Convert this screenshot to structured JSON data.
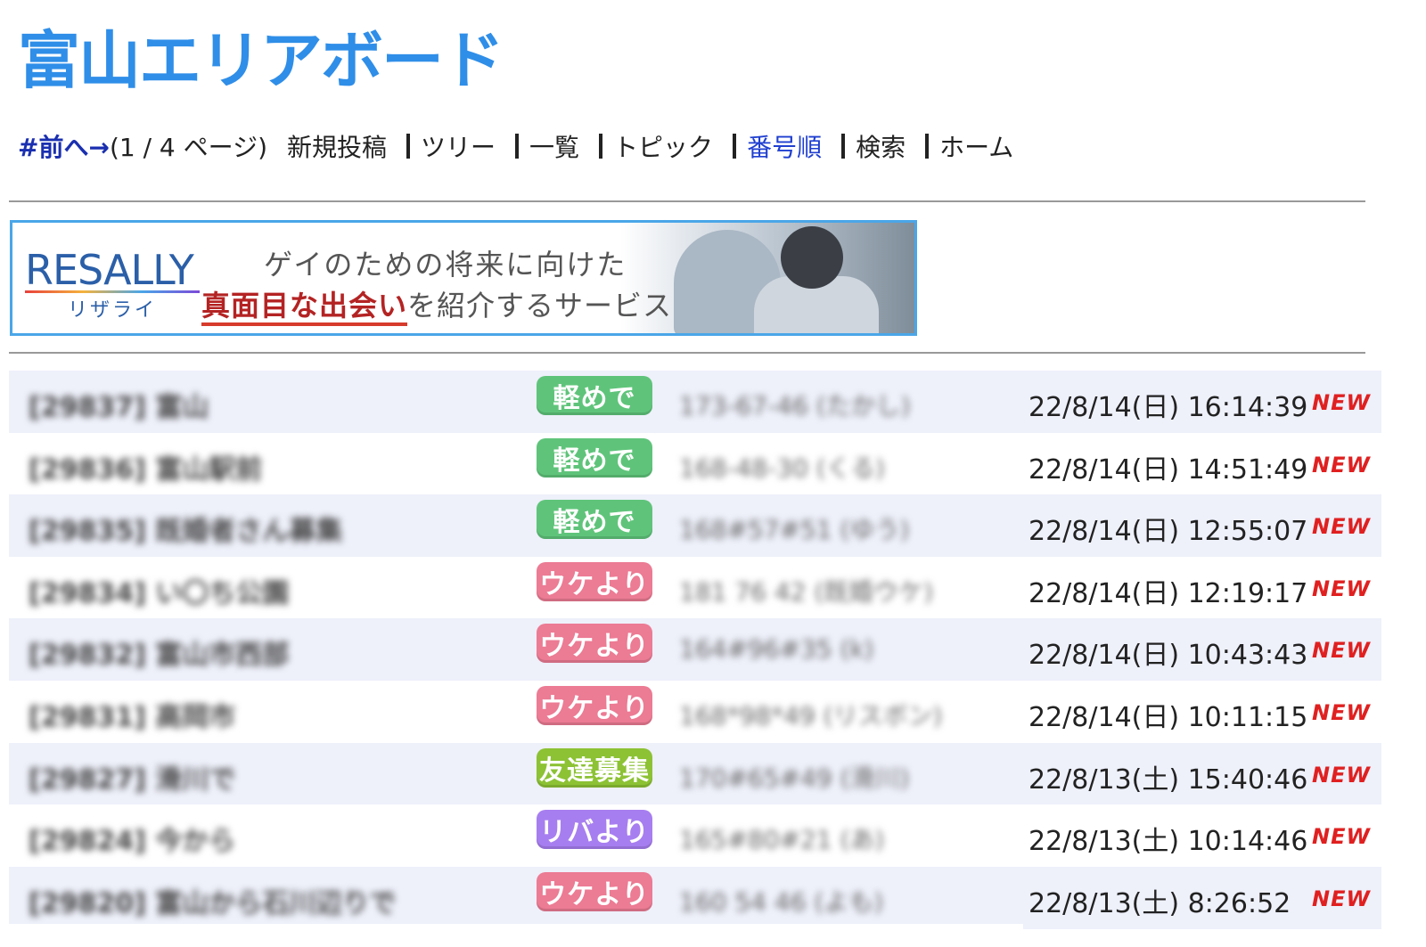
{
  "site": {
    "title": "富山エリアボード"
  },
  "nav": {
    "prev": "#前へ→",
    "page_info": "(1 / 4 ページ)",
    "items": [
      {
        "label": "新規投稿",
        "active": false
      },
      {
        "label": "ツリー",
        "active": false
      },
      {
        "label": "一覧",
        "active": false
      },
      {
        "label": "トピック",
        "active": false
      },
      {
        "label": "番号順",
        "active": true
      },
      {
        "label": "検索",
        "active": false
      },
      {
        "label": "ホーム",
        "active": false
      }
    ]
  },
  "banner": {
    "brand": "RESALLY",
    "brand_sub": "リザライ",
    "line1": "ゲイのための将来に向けた",
    "line2_highlight": "真面目な出会い",
    "line2_rest": "を紹介するサービス"
  },
  "posts": [
    {
      "title": "[29837] 富山",
      "tag": "軽めで",
      "tag_color": "green",
      "meta": "173-67-46 (たかし)",
      "date": "22/8/14(日) 16:14:39",
      "new": "NEW"
    },
    {
      "title": "[29836] 富山駅前",
      "tag": "軽めで",
      "tag_color": "green",
      "meta": "168-48-30 (くる)",
      "date": "22/8/14(日) 14:51:49",
      "new": "NEW"
    },
    {
      "title": "[29835] 既婚者さん募集",
      "tag": "軽めで",
      "tag_color": "green",
      "meta": "168#57#51 (ゆう)",
      "date": "22/8/14(日) 12:55:07",
      "new": "NEW"
    },
    {
      "title": "[29834] い〇ち公園",
      "tag": "ウケより",
      "tag_color": "pink",
      "meta": "181 76 42 (既婚ウケ)",
      "date": "22/8/14(日) 12:19:17",
      "new": "NEW"
    },
    {
      "title": "[29832] 富山市西部",
      "tag": "ウケより",
      "tag_color": "pink",
      "meta": "164#96#35 (k)",
      "date": "22/8/14(日) 10:43:43",
      "new": "NEW"
    },
    {
      "title": "[29831] 高岡市",
      "tag": "ウケより",
      "tag_color": "pink",
      "meta": "168*98*49 (リスボン)",
      "date": "22/8/14(日) 10:11:15",
      "new": "NEW"
    },
    {
      "title": "[29827] 滑川で",
      "tag": "友達募集",
      "tag_color": "lime",
      "meta": "170#65#49 (滑川)",
      "date": "22/8/13(土) 15:40:46",
      "new": "NEW"
    },
    {
      "title": "[29824] 今から",
      "tag": "リバより",
      "tag_color": "purple",
      "meta": "165#80#21 (あ)",
      "date": "22/8/13(土) 10:14:46",
      "new": "NEW"
    },
    {
      "title": "[29820] 富山から石川辺りで",
      "tag": "ウケより",
      "tag_color": "pink",
      "meta": "160 54 46 (よも)",
      "date": "22/8/13(土) 8:26:52",
      "new": "NEW"
    }
  ]
}
